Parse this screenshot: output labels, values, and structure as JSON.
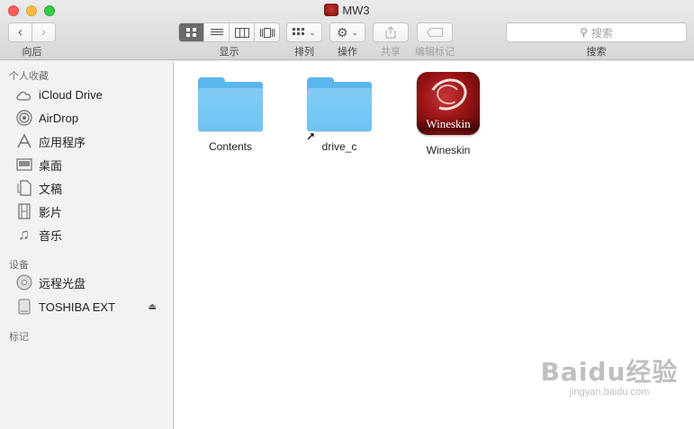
{
  "window": {
    "title": "MW3"
  },
  "toolbar": {
    "back_glyph": "‹",
    "forward_glyph": "›",
    "nav_label": "向后",
    "view_label": "显示",
    "arrange_label": "排列",
    "action_label": "操作",
    "share_label": "共享",
    "tags_label": "编辑标记",
    "search_label": "搜索",
    "search_placeholder": "搜索",
    "active_view": "icon"
  },
  "sidebar": {
    "favorites_heading": "个人收藏",
    "favorites": [
      {
        "label": "iCloud Drive",
        "icon": "cloud-icon"
      },
      {
        "label": "AirDrop",
        "icon": "airdrop-icon"
      },
      {
        "label": "应用程序",
        "icon": "applications-icon"
      },
      {
        "label": "桌面",
        "icon": "desktop-icon"
      },
      {
        "label": "文稿",
        "icon": "documents-icon"
      },
      {
        "label": "影片",
        "icon": "movies-icon"
      },
      {
        "label": "音乐",
        "icon": "music-icon"
      }
    ],
    "devices_heading": "设备",
    "devices": [
      {
        "label": "远程光盘",
        "icon": "disc-icon"
      },
      {
        "label": "TOSHIBA EXT",
        "icon": "external-drive-icon",
        "ejectable": true
      }
    ],
    "tags_heading": "标记"
  },
  "content": {
    "items": [
      {
        "name": "Contents",
        "kind": "folder"
      },
      {
        "name": "drive_c",
        "kind": "folder-alias"
      },
      {
        "name": "Wineskin",
        "kind": "app",
        "badge_text": "Wineskin"
      }
    ]
  },
  "watermark": {
    "line1": "Baidu经验",
    "line2": "jingyan.baidu.com"
  },
  "colors": {
    "folder": "#6ec3f4",
    "close": "#fc605b",
    "minimize": "#fdbc40",
    "maximize": "#34c84a",
    "app_icon": "#9a1414"
  }
}
